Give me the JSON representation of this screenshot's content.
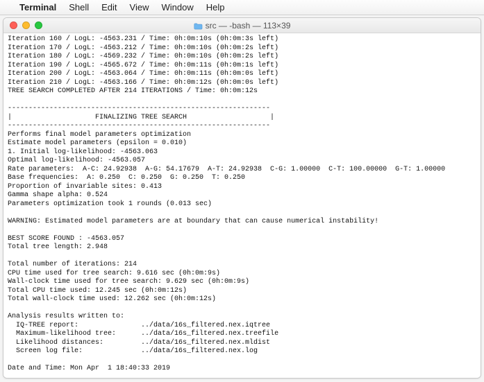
{
  "menubar": {
    "items": [
      "Terminal",
      "Shell",
      "Edit",
      "View",
      "Window",
      "Help"
    ]
  },
  "window": {
    "title": "src — -bash — 113×39",
    "folder_icon": "folder-icon"
  },
  "iterations": [
    {
      "n": 160,
      "logl": "-4563.231",
      "t": "0h:0m:10s",
      "left": "0h:0m:3s"
    },
    {
      "n": 170,
      "logl": "-4563.212",
      "t": "0h:0m:10s",
      "left": "0h:0m:2s"
    },
    {
      "n": 180,
      "logl": "-4569.232",
      "t": "0h:0m:10s",
      "left": "0h:0m:2s"
    },
    {
      "n": 190,
      "logl": "-4565.672",
      "t": "0h:0m:11s",
      "left": "0h:0m:1s"
    },
    {
      "n": 200,
      "logl": "-4563.064",
      "t": "0h:0m:11s",
      "left": "0h:0m:0s"
    },
    {
      "n": 210,
      "logl": "-4563.166",
      "t": "0h:0m:12s",
      "left": "0h:0m:0s"
    }
  ],
  "search_complete": "TREE SEARCH COMPLETED AFTER 214 ITERATIONS / Time: 0h:0m:12s",
  "section_rule": "---------------------------------------------------------------",
  "section_title": "|                    FINALIZING TREE SEARCH                    |",
  "final": {
    "l1": "Performs final model parameters optimization",
    "l2": "Estimate model parameters (epsilon = 0.010)",
    "l3": "1. Initial log-likelihood: -4563.063",
    "l4": "Optimal log-likelihood: -4563.057",
    "l5": "Rate parameters:  A-C: 24.92938  A-G: 54.17679  A-T: 24.92938  C-G: 1.00000  C-T: 100.00000  G-T: 1.00000",
    "l6": "Base frequencies:  A: 0.250  C: 0.250  G: 0.250  T: 0.250",
    "l7": "Proportion of invariable sites: 0.413",
    "l8": "Gamma shape alpha: 0.524",
    "l9": "Parameters optimization took 1 rounds (0.013 sec)"
  },
  "warning": "WARNING: Estimated model parameters are at boundary that can cause numerical instability!",
  "best_score": "BEST SCORE FOUND : -4563.057",
  "tree_len": "Total tree length: 2.948",
  "stats": {
    "iters": "Total number of iterations: 214",
    "cpu_search": "CPU time used for tree search: 9.616 sec (0h:0m:9s)",
    "wall_search": "Wall-clock time used for tree search: 9.629 sec (0h:0m:9s)",
    "cpu_total": "Total CPU time used: 12.245 sec (0h:0m:12s)",
    "wall_total": "Total wall-clock time used: 12.262 sec (0h:0m:12s)"
  },
  "results_header": "Analysis results written to:",
  "results": {
    "r1": "  IQ-TREE report:               ../data/16s_filtered.nex.iqtree",
    "r2": "  Maximum-likelihood tree:      ../data/16s_filtered.nex.treefile",
    "r3": "  Likelihood distances:         ../data/16s_filtered.nex.mldist",
    "r4": "  Screen log file:              ../data/16s_filtered.nex.log"
  },
  "datetime": "Date and Time: Mon Apr  1 18:40:33 2019"
}
